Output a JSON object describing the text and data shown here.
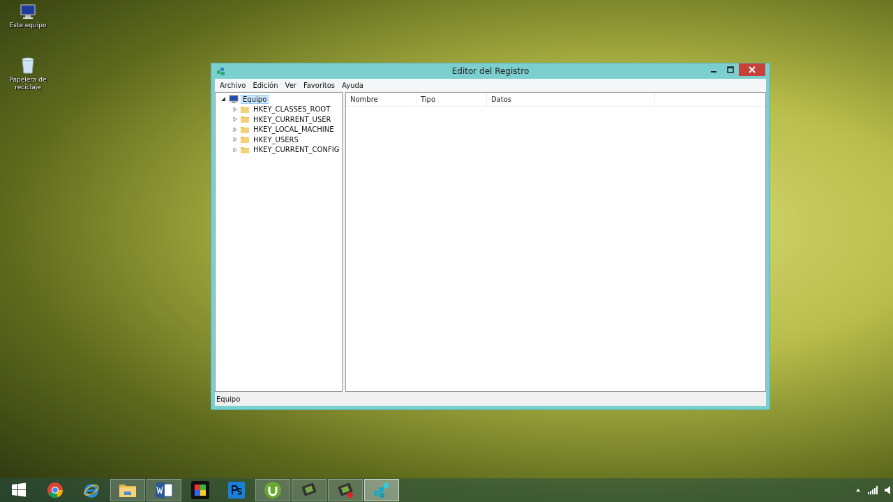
{
  "desktop_icons": [
    {
      "kind": "computer",
      "label": "Este equipo"
    },
    {
      "kind": "recycle",
      "label": "Papelera de reciclaje"
    }
  ],
  "window": {
    "title": "Editor del Registro",
    "menu": [
      "Archivo",
      "Edición",
      "Ver",
      "Favoritos",
      "Ayuda"
    ],
    "tree": [
      {
        "label": "Equipo",
        "kind": "computer",
        "selected": true,
        "expanded": true,
        "children": [
          {
            "label": "HKEY_CLASSES_ROOT",
            "kind": "folder",
            "selected": false,
            "expanded": false
          },
          {
            "label": "HKEY_CURRENT_USER",
            "kind": "folder",
            "selected": false,
            "expanded": false
          },
          {
            "label": "HKEY_LOCAL_MACHINE",
            "kind": "folder",
            "selected": false,
            "expanded": false
          },
          {
            "label": "HKEY_USERS",
            "kind": "folder",
            "selected": false,
            "expanded": false
          },
          {
            "label": "HKEY_CURRENT_CONFIG",
            "kind": "folder",
            "selected": false,
            "expanded": false
          }
        ]
      }
    ],
    "columns": [
      "Nombre",
      "Tipo",
      "Datos"
    ],
    "status_bar": "Equipo"
  },
  "taskbar": [
    {
      "kind": "start",
      "running": false,
      "selected": false
    },
    {
      "kind": "chrome",
      "running": false,
      "selected": false
    },
    {
      "kind": "ie",
      "running": false,
      "selected": false
    },
    {
      "kind": "explorer",
      "running": true,
      "selected": false
    },
    {
      "kind": "word",
      "running": true,
      "selected": false
    },
    {
      "kind": "puzzle",
      "running": false,
      "selected": false
    },
    {
      "kind": "photoshop",
      "running": false,
      "selected": false
    },
    {
      "kind": "torrent",
      "running": true,
      "selected": false
    },
    {
      "kind": "app",
      "running": true,
      "selected": false
    },
    {
      "kind": "app-record",
      "running": true,
      "selected": false
    },
    {
      "kind": "registry",
      "running": true,
      "selected": true
    }
  ]
}
